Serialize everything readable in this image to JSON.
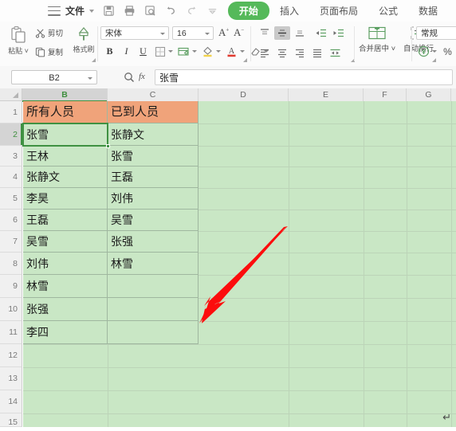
{
  "menubar": {
    "hamburger_icon": "hamburger-icon",
    "file_label": "文件",
    "quick_icons": [
      "save-icon",
      "print-icon",
      "print-preview-icon",
      "undo-icon",
      "redo-icon",
      "customize-icon"
    ],
    "tabs": [
      {
        "label": "开始",
        "active": true
      },
      {
        "label": "插入",
        "active": false
      },
      {
        "label": "页面布局",
        "active": false
      },
      {
        "label": "公式",
        "active": false
      },
      {
        "label": "数据",
        "active": false
      }
    ],
    "accent_color": "#55b95a"
  },
  "ribbon": {
    "paste_label": "粘贴",
    "cut_label": "剪切",
    "copy_label": "复制",
    "format_painter_label": "格式刷",
    "font_name": "宋体",
    "font_size": "16",
    "grow_font": "A",
    "shrink_font": "A",
    "bold": "B",
    "italic": "I",
    "underline": "U",
    "merge_center_label": "合并居中",
    "wrap_text_label": "自动换行",
    "number_format": "常规",
    "percent_label": "%"
  },
  "formula_bar": {
    "name_box": "B2",
    "fx_label": "fx",
    "formula_value": "张雪",
    "search_icon": "search-icon"
  },
  "grid": {
    "columns": [
      {
        "label": "B",
        "selected": true
      },
      {
        "label": "C",
        "selected": false
      },
      {
        "label": "D",
        "selected": false
      },
      {
        "label": "E",
        "selected": false
      },
      {
        "label": "F",
        "selected": false
      },
      {
        "label": "G",
        "selected": false
      }
    ],
    "rows": [
      "1",
      "2",
      "3",
      "4",
      "5",
      "6",
      "7",
      "8",
      "9",
      "10",
      "11",
      "12",
      "13",
      "14",
      "15"
    ],
    "selected_row": "2",
    "header_cells": {
      "b": "所有人员",
      "c": "已到人员"
    },
    "data": [
      {
        "b": "张雪",
        "c": "张静文"
      },
      {
        "b": "王林",
        "c": "张雪"
      },
      {
        "b": "张静文",
        "c": "王磊"
      },
      {
        "b": "李昊",
        "c": "刘伟"
      },
      {
        "b": "王磊",
        "c": "吴雪"
      },
      {
        "b": "吴雪",
        "c": "张强"
      },
      {
        "b": "刘伟",
        "c": "林雪"
      },
      {
        "b": "林雪",
        "c": ""
      },
      {
        "b": "张强",
        "c": ""
      },
      {
        "b": "李四",
        "c": ""
      }
    ],
    "colors": {
      "header_fill": "#f0a37a",
      "data_fill": "#c9e7c5",
      "selection_border": "#3f9142",
      "gridline": "#9fb79f"
    }
  },
  "annotation": {
    "arrow_color": "#fc0d0d",
    "arrow_from": "360,285",
    "arrow_to": "250,406"
  },
  "cursor": {
    "glyph": "↵"
  }
}
